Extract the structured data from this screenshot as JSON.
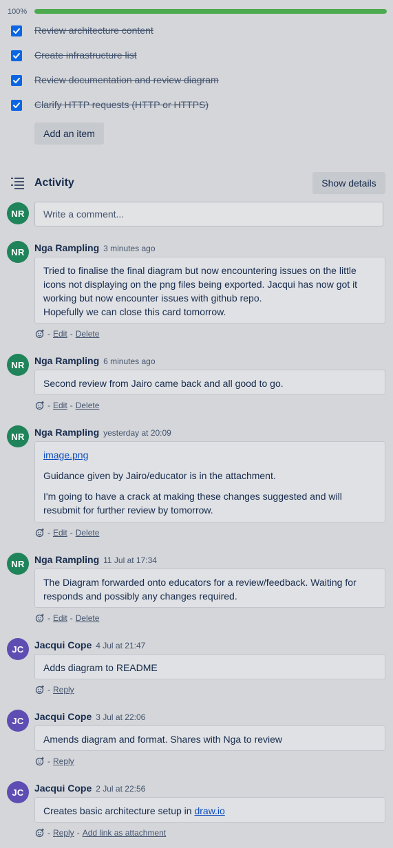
{
  "checklist": {
    "progress_label": "100%",
    "progress_value": 1.0,
    "items": [
      {
        "label": "Review architecture content",
        "checked": true
      },
      {
        "label": "Create infrastructure list",
        "checked": true
      },
      {
        "label": "Review documentation and review diagram",
        "checked": true
      },
      {
        "label": "Clarify HTTP requests (HTTP or HTTPS)",
        "checked": true
      }
    ],
    "add_item_label": "Add an item"
  },
  "activity": {
    "title": "Activity",
    "show_details_label": "Show details",
    "current_user_initials": "NR",
    "comment_placeholder": "Write a comment..."
  },
  "comments": [
    {
      "initials": "NR",
      "author": "Nga Rampling",
      "time": "3 minutes ago",
      "lines": [
        "Tried to finalise the final diagram but now encountering issues on the little",
        "icons not displaying on the png files being exported. Jacqui has now got it",
        "working but now encounter issues with github repo.",
        "Hopefully we can close this card tomorrow."
      ],
      "actions": [
        "Edit",
        "Delete"
      ]
    },
    {
      "initials": "NR",
      "author": "Nga Rampling",
      "time": "6 minutes ago",
      "lines": [
        "Second review from Jairo came back and all good to go."
      ],
      "actions": [
        "Edit",
        "Delete"
      ]
    },
    {
      "initials": "NR",
      "author": "Nga Rampling",
      "time": "yesterday at 20:09",
      "link": "image.png",
      "para1": "Guidance given by Jairo/educator is in the attachment.",
      "para2_lines": [
        "I'm going to have a crack at making these changes suggested and will",
        "resubmit for further review by tomorrow."
      ],
      "actions": [
        "Edit",
        "Delete"
      ]
    },
    {
      "initials": "NR",
      "author": "Nga Rampling",
      "time": "11 Jul at 17:34",
      "lines": [
        "The Diagram forwarded onto educators for a review/feedback. Waiting for",
        "responds and possibly any changes required."
      ],
      "actions": [
        "Edit",
        "Delete"
      ]
    },
    {
      "initials": "JC",
      "author": "Jacqui Cope",
      "time": "4 Jul at 21:47",
      "lines": [
        "Adds diagram to README"
      ],
      "actions": [
        "Reply"
      ]
    },
    {
      "initials": "JC",
      "author": "Jacqui Cope",
      "time": "3 Jul at 22:06",
      "lines": [
        "Amends diagram and format. Shares with Nga to review"
      ],
      "actions": [
        "Reply"
      ]
    },
    {
      "initials": "JC",
      "author": "Jacqui Cope",
      "time": "2 Jul at 22:56",
      "text_prefix": "Creates basic architecture setup in ",
      "link": "draw.io",
      "actions": [
        "Reply",
        "Add link as attachment"
      ]
    }
  ],
  "icons": {
    "checkbox": "check-icon",
    "activity": "activity-list-icon",
    "reaction": "add-reaction-icon"
  },
  "colors": {
    "progress": "#4caa4f",
    "checkbox": "#0c66e4",
    "avatar_nr": "#1f845a",
    "avatar_jc": "#5e4db2",
    "link": "#0c4bbf"
  }
}
